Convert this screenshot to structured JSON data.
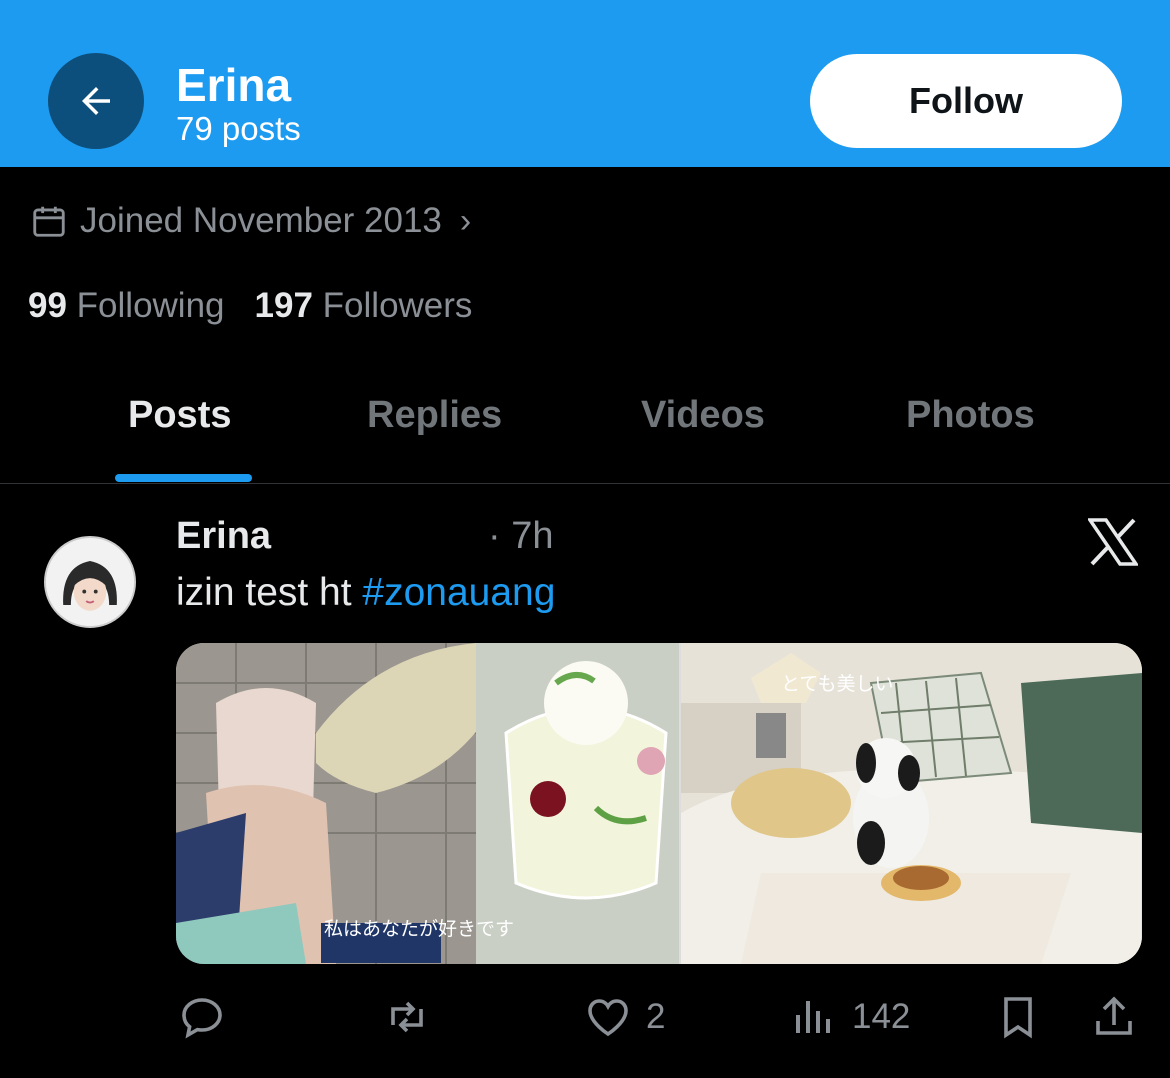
{
  "header": {
    "name": "Erina",
    "posts_count": "79 posts",
    "follow_label": "Follow"
  },
  "profile": {
    "joined": "Joined November 2013",
    "following_count": "99",
    "following_label": "Following",
    "followers_count": "197",
    "followers_label": "Followers"
  },
  "tabs": [
    {
      "label": "Posts",
      "active": true
    },
    {
      "label": "Replies",
      "active": false
    },
    {
      "label": "Videos",
      "active": false
    },
    {
      "label": "Photos",
      "active": false
    }
  ],
  "post": {
    "author": "Erina",
    "time": "· 7h",
    "text": "izin test ht ",
    "hashtag": "#zonauang",
    "media_caption_left": "私はあなたが好きです",
    "media_caption_right": "とても美しい",
    "likes": "2",
    "views": "142"
  },
  "colors": {
    "accent": "#1d9bf0",
    "back_button": "#0d4f7c",
    "background": "#000000",
    "muted": "#8b9096"
  },
  "icons": [
    "arrow-left-icon",
    "calendar-icon",
    "chevron-right-icon",
    "x-logo-icon",
    "reply-icon",
    "repost-icon",
    "like-icon",
    "views-icon",
    "bookmark-icon",
    "share-icon"
  ]
}
